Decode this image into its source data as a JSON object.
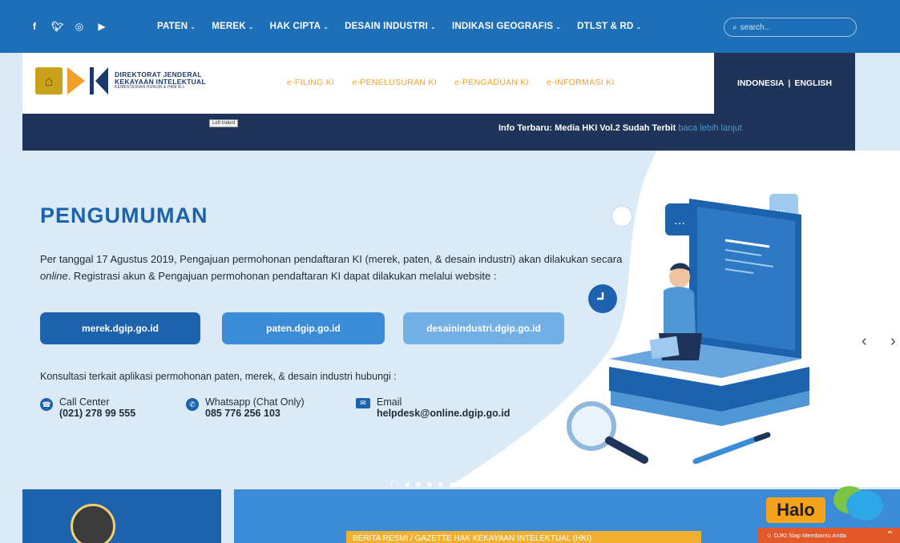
{
  "social": [
    "f",
    "t",
    "ig",
    "yt"
  ],
  "nav": {
    "items": [
      "PATEN",
      "MEREK",
      "HAK CIPTA",
      "DESAIN INDUSTRI",
      "INDIKASI GEOGRAFIS",
      "DTLST & RD"
    ],
    "search_placeholder": "search..."
  },
  "header": {
    "logo_line1": "DIREKTORAT JENDERAL",
    "logo_line2": "KEKAYAAN INTELEKTUAL",
    "logo_line3": "KEMENTERIAN HUKUM & HAM R.I.",
    "eservices": [
      "e-FILING KI",
      "e-PENELUSURAN KI",
      "e-PENGADUAN KI",
      "e-INFORMASI KI"
    ],
    "lang_indonesia": "INDONESIA",
    "lang_english": "ENGLISH"
  },
  "infobar": {
    "tooltip": "Left Indent",
    "news_label": "Info Terbaru: Media HKI Vol.2 Sudah Terbit",
    "news_more": "baca lebih lanjut"
  },
  "hero": {
    "title": "PENGUMUMAN",
    "text_part1": "Per tanggal 17 Agustus 2019, Pengajuan permohonan pendaftaran KI (merek, paten, & desain industri) akan dilakukan secara ",
    "text_online": "online",
    "text_part2": ". Registrasi akun & Pengajuan permohonan pendaftaran KI dapat dilakukan melalui website :",
    "buttons": [
      "merek.dgip.go.id",
      "paten.dgip.go.id",
      "desainindustri.dgip.go.id"
    ],
    "consult": "Konsultasi terkait aplikasi permohonan paten, merek, & desain industri hubungi :",
    "contacts": [
      {
        "label": "Call Center",
        "value": "(021) 278 99 555"
      },
      {
        "label": "Whatsapp (Chat Only)",
        "value": "085 776 256 103"
      },
      {
        "label": "Email",
        "value": "helpdesk@online.dgip.go.id"
      }
    ],
    "slide_count": 6,
    "active_slide": 1
  },
  "ticker": "BERITA RESMI / GAZETTE HAK KEKAYAAN INTELEKTUAL (HKI)",
  "chat": {
    "halo": "Halo",
    "bar_text": "DJKI Siap Membantu Anda"
  },
  "colors": {
    "topbar": "#1d6fb8",
    "navy": "#1e3458",
    "accent_orange": "#f0a02a",
    "title_blue": "#1c62ad",
    "hero_bg": "#dbeaf7"
  }
}
